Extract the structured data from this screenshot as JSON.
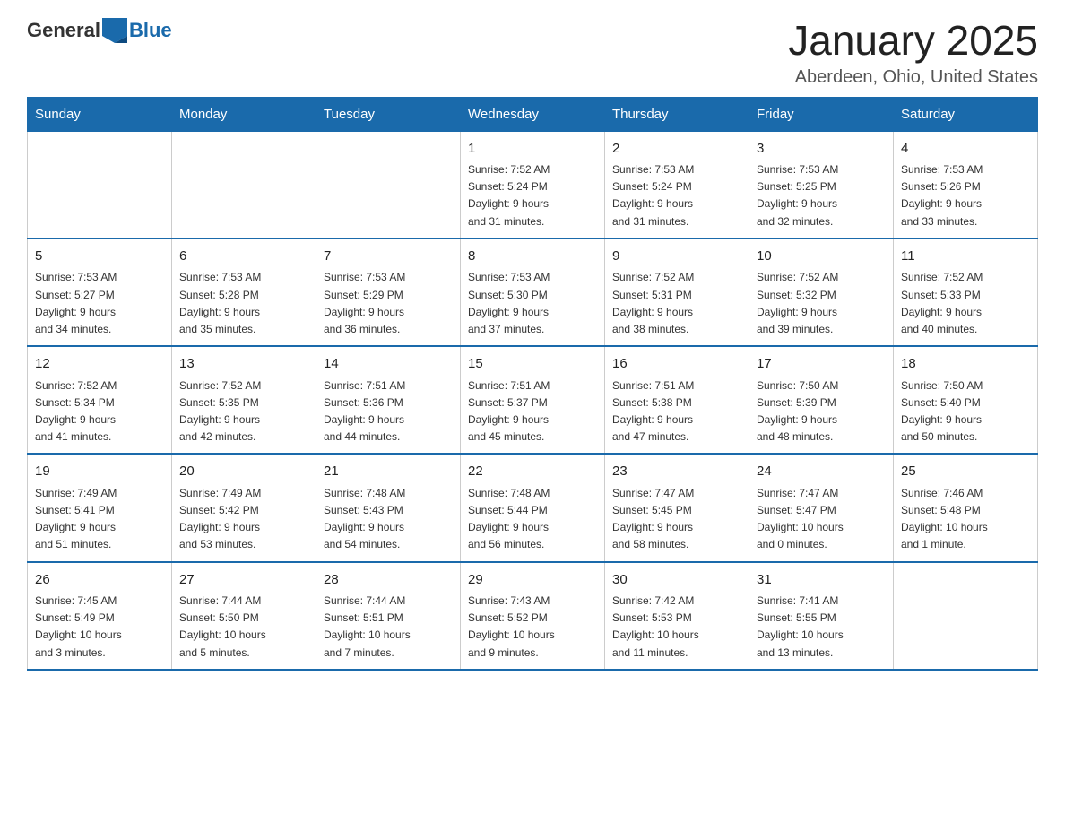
{
  "logo": {
    "general": "General",
    "blue": "Blue"
  },
  "header": {
    "title": "January 2025",
    "location": "Aberdeen, Ohio, United States"
  },
  "weekdays": [
    "Sunday",
    "Monday",
    "Tuesday",
    "Wednesday",
    "Thursday",
    "Friday",
    "Saturday"
  ],
  "weeks": [
    [
      {
        "day": "",
        "info": ""
      },
      {
        "day": "",
        "info": ""
      },
      {
        "day": "",
        "info": ""
      },
      {
        "day": "1",
        "info": "Sunrise: 7:52 AM\nSunset: 5:24 PM\nDaylight: 9 hours\nand 31 minutes."
      },
      {
        "day": "2",
        "info": "Sunrise: 7:53 AM\nSunset: 5:24 PM\nDaylight: 9 hours\nand 31 minutes."
      },
      {
        "day": "3",
        "info": "Sunrise: 7:53 AM\nSunset: 5:25 PM\nDaylight: 9 hours\nand 32 minutes."
      },
      {
        "day": "4",
        "info": "Sunrise: 7:53 AM\nSunset: 5:26 PM\nDaylight: 9 hours\nand 33 minutes."
      }
    ],
    [
      {
        "day": "5",
        "info": "Sunrise: 7:53 AM\nSunset: 5:27 PM\nDaylight: 9 hours\nand 34 minutes."
      },
      {
        "day": "6",
        "info": "Sunrise: 7:53 AM\nSunset: 5:28 PM\nDaylight: 9 hours\nand 35 minutes."
      },
      {
        "day": "7",
        "info": "Sunrise: 7:53 AM\nSunset: 5:29 PM\nDaylight: 9 hours\nand 36 minutes."
      },
      {
        "day": "8",
        "info": "Sunrise: 7:53 AM\nSunset: 5:30 PM\nDaylight: 9 hours\nand 37 minutes."
      },
      {
        "day": "9",
        "info": "Sunrise: 7:52 AM\nSunset: 5:31 PM\nDaylight: 9 hours\nand 38 minutes."
      },
      {
        "day": "10",
        "info": "Sunrise: 7:52 AM\nSunset: 5:32 PM\nDaylight: 9 hours\nand 39 minutes."
      },
      {
        "day": "11",
        "info": "Sunrise: 7:52 AM\nSunset: 5:33 PM\nDaylight: 9 hours\nand 40 minutes."
      }
    ],
    [
      {
        "day": "12",
        "info": "Sunrise: 7:52 AM\nSunset: 5:34 PM\nDaylight: 9 hours\nand 41 minutes."
      },
      {
        "day": "13",
        "info": "Sunrise: 7:52 AM\nSunset: 5:35 PM\nDaylight: 9 hours\nand 42 minutes."
      },
      {
        "day": "14",
        "info": "Sunrise: 7:51 AM\nSunset: 5:36 PM\nDaylight: 9 hours\nand 44 minutes."
      },
      {
        "day": "15",
        "info": "Sunrise: 7:51 AM\nSunset: 5:37 PM\nDaylight: 9 hours\nand 45 minutes."
      },
      {
        "day": "16",
        "info": "Sunrise: 7:51 AM\nSunset: 5:38 PM\nDaylight: 9 hours\nand 47 minutes."
      },
      {
        "day": "17",
        "info": "Sunrise: 7:50 AM\nSunset: 5:39 PM\nDaylight: 9 hours\nand 48 minutes."
      },
      {
        "day": "18",
        "info": "Sunrise: 7:50 AM\nSunset: 5:40 PM\nDaylight: 9 hours\nand 50 minutes."
      }
    ],
    [
      {
        "day": "19",
        "info": "Sunrise: 7:49 AM\nSunset: 5:41 PM\nDaylight: 9 hours\nand 51 minutes."
      },
      {
        "day": "20",
        "info": "Sunrise: 7:49 AM\nSunset: 5:42 PM\nDaylight: 9 hours\nand 53 minutes."
      },
      {
        "day": "21",
        "info": "Sunrise: 7:48 AM\nSunset: 5:43 PM\nDaylight: 9 hours\nand 54 minutes."
      },
      {
        "day": "22",
        "info": "Sunrise: 7:48 AM\nSunset: 5:44 PM\nDaylight: 9 hours\nand 56 minutes."
      },
      {
        "day": "23",
        "info": "Sunrise: 7:47 AM\nSunset: 5:45 PM\nDaylight: 9 hours\nand 58 minutes."
      },
      {
        "day": "24",
        "info": "Sunrise: 7:47 AM\nSunset: 5:47 PM\nDaylight: 10 hours\nand 0 minutes."
      },
      {
        "day": "25",
        "info": "Sunrise: 7:46 AM\nSunset: 5:48 PM\nDaylight: 10 hours\nand 1 minute."
      }
    ],
    [
      {
        "day": "26",
        "info": "Sunrise: 7:45 AM\nSunset: 5:49 PM\nDaylight: 10 hours\nand 3 minutes."
      },
      {
        "day": "27",
        "info": "Sunrise: 7:44 AM\nSunset: 5:50 PM\nDaylight: 10 hours\nand 5 minutes."
      },
      {
        "day": "28",
        "info": "Sunrise: 7:44 AM\nSunset: 5:51 PM\nDaylight: 10 hours\nand 7 minutes."
      },
      {
        "day": "29",
        "info": "Sunrise: 7:43 AM\nSunset: 5:52 PM\nDaylight: 10 hours\nand 9 minutes."
      },
      {
        "day": "30",
        "info": "Sunrise: 7:42 AM\nSunset: 5:53 PM\nDaylight: 10 hours\nand 11 minutes."
      },
      {
        "day": "31",
        "info": "Sunrise: 7:41 AM\nSunset: 5:55 PM\nDaylight: 10 hours\nand 13 minutes."
      },
      {
        "day": "",
        "info": ""
      }
    ]
  ]
}
